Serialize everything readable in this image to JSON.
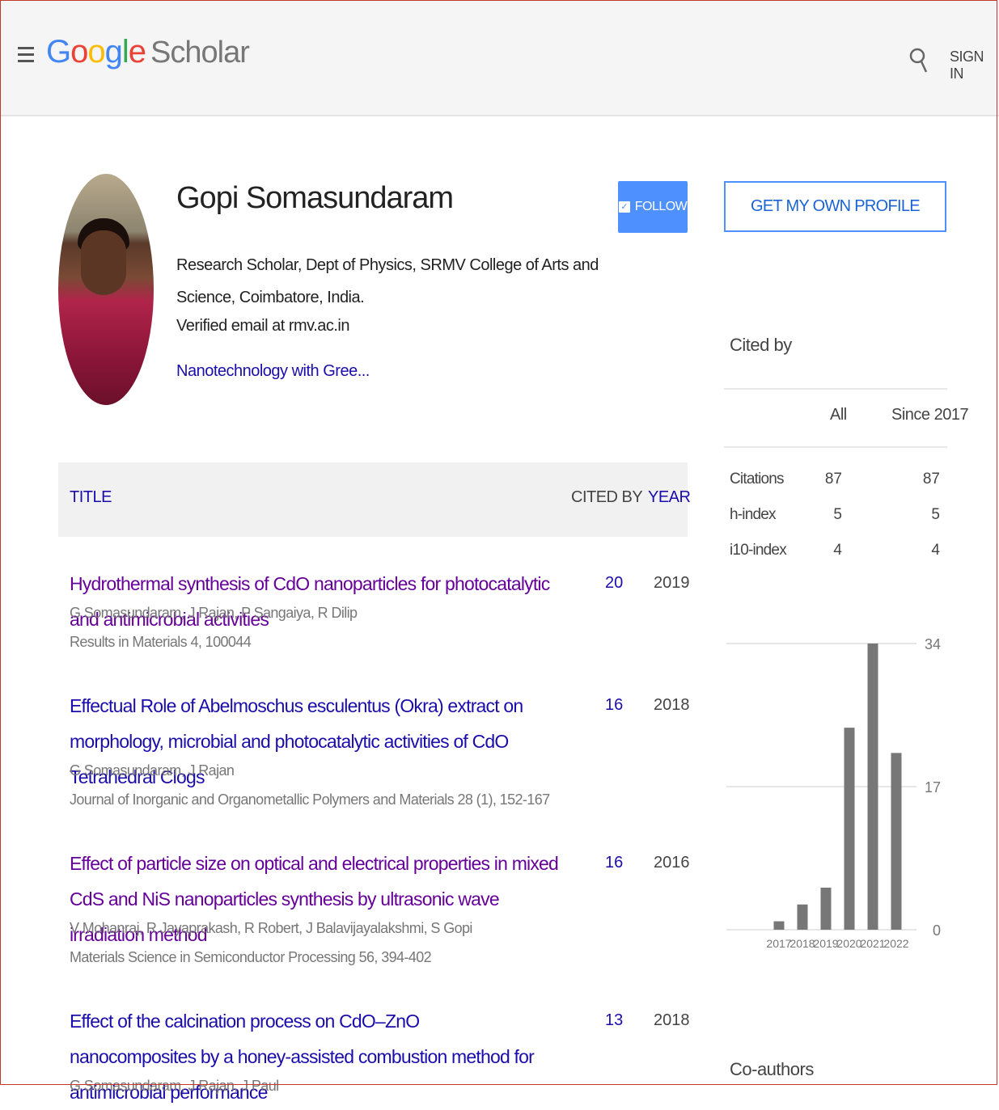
{
  "header": {
    "logo_google": [
      "G",
      "o",
      "o",
      "g",
      "l",
      "e"
    ],
    "logo_scholar": "Scholar",
    "signin_label": "SIGN IN"
  },
  "profile": {
    "name": "Gopi Somasundaram",
    "affiliation": "Research Scholar, Dept of Physics, SRMV College of Arts and Science, Coimbatore, India.",
    "email": "Verified email at rmv.ac.in",
    "interest": "Nanotechnology with Gree...",
    "follow_label": "FOLLOW"
  },
  "table": {
    "headers": {
      "title": "TITLE",
      "cited_by": "CITED BY",
      "year": "YEAR"
    },
    "rows": [
      {
        "title": "Hydrothermal synthesis of CdO nanoparticles for photocatalytic and antimicrobial activities",
        "authors": "G Somasundaram, J Rajan, P Sangaiya, R Dilip",
        "venue": "Results in Materials 4, 100044",
        "cited_by": "20",
        "year": "2019"
      },
      {
        "title": "Effectual Role of Abelmoschus esculentus (Okra) extract on morphology, microbial and photocatalytic activities of CdO Tetrahedral Clogs",
        "authors": "G Somasundaram, J Rajan",
        "venue": "Journal of Inorganic and Organometallic Polymers and Materials 28 (1), 152-167",
        "cited_by": "16",
        "year": "2018"
      },
      {
        "title": "Effect of particle size on optical and electrical properties in mixed CdS and NiS nanoparticles synthesis by ultrasonic wave irradiation method",
        "authors": "V Mohanraj, R Jayaprakash, R Robert, J Balavijayalakshmi, S Gopi",
        "venue": "Materials Science in Semiconductor Processing 56, 394-402",
        "cited_by": "16",
        "year": "2016"
      },
      {
        "title": "Effect of the calcination process on CdO–ZnO nanocomposites by a honey-assisted combustion method for antimicrobial performance",
        "authors": "G Somasundaram, J Rajan, J Paul",
        "venue": "",
        "cited_by": "13",
        "year": "2018"
      }
    ]
  },
  "sidebar": {
    "own_profile_label": "GET MY OWN PROFILE",
    "cited_by_label": "Cited by",
    "col_all": "All",
    "col_since": "Since 2017",
    "stats": [
      {
        "label": "Citations",
        "all": "87",
        "since": "87"
      },
      {
        "label": "h-index",
        "all": "5",
        "since": "5"
      },
      {
        "label": "i10-index",
        "all": "4",
        "since": "4"
      }
    ],
    "coauthors_label": "Co-authors"
  },
  "chart_data": {
    "type": "bar",
    "categories": [
      "2017",
      "2018",
      "2019",
      "2020",
      "2021",
      "2022"
    ],
    "values": [
      1,
      3,
      5,
      24,
      34,
      21
    ],
    "ylim": [
      0,
      34
    ],
    "yticks": [
      "0",
      "17",
      "34"
    ],
    "grid": true,
    "bar_color": "#777777"
  },
  "colors": {
    "link": "#1a0dab",
    "visited": "#660099",
    "accent": "#4d90fe"
  }
}
